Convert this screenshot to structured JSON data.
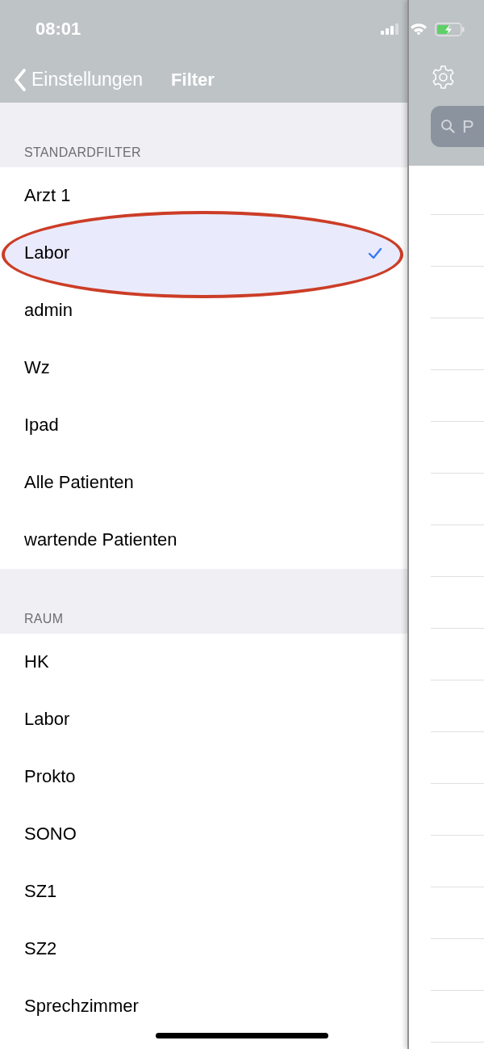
{
  "status_bar": {
    "time": "08:01"
  },
  "nav_bar": {
    "back_label": "Einstellungen",
    "title": "Filter"
  },
  "sections": [
    {
      "header": "STANDARDFILTER",
      "items": [
        {
          "label": "Arzt 1",
          "selected": false,
          "circled": false
        },
        {
          "label": "Labor",
          "selected": true,
          "circled": true
        },
        {
          "label": "admin",
          "selected": false,
          "circled": false
        },
        {
          "label": "Wz",
          "selected": false,
          "circled": false
        },
        {
          "label": "Ipad",
          "selected": false,
          "circled": false
        },
        {
          "label": "Alle Patienten",
          "selected": false,
          "circled": false
        },
        {
          "label": "wartende Patienten",
          "selected": false,
          "circled": false
        }
      ]
    },
    {
      "header": "RAUM",
      "items": [
        {
          "label": "HK",
          "selected": false,
          "circled": false
        },
        {
          "label": "Labor",
          "selected": false,
          "circled": false
        },
        {
          "label": "Prokto",
          "selected": false,
          "circled": false
        },
        {
          "label": "SONO",
          "selected": false,
          "circled": false
        },
        {
          "label": "SZ1",
          "selected": false,
          "circled": false
        },
        {
          "label": "SZ2",
          "selected": false,
          "circled": false
        },
        {
          "label": "Sprechzimmer",
          "selected": false,
          "circled": false
        }
      ]
    }
  ],
  "side_panel": {
    "search": {
      "placeholder": "P"
    }
  }
}
